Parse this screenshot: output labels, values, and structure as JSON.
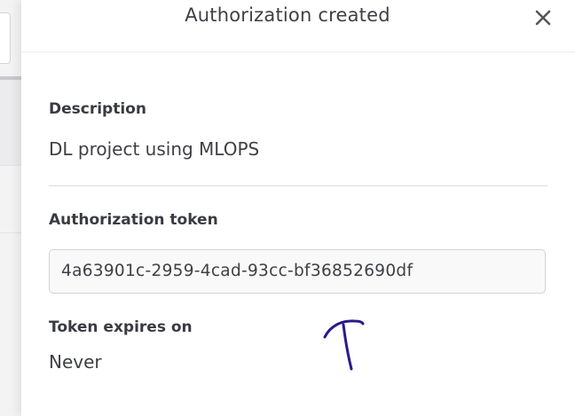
{
  "dialog": {
    "title": "Authorization created"
  },
  "fields": {
    "description_label": "Description",
    "description_value": "DL project using MLOPS",
    "token_label": "Authorization token",
    "token_value": "4a63901c-2959-4cad-93cc-bf36852690df",
    "expires_label": "Token expires on",
    "expires_value": "Never"
  },
  "icons": {
    "close": "close-icon",
    "annotation": "handwritten-arrow"
  },
  "colors": {
    "annotation_ink": "#2a1a8c",
    "text": "#3f4046"
  }
}
